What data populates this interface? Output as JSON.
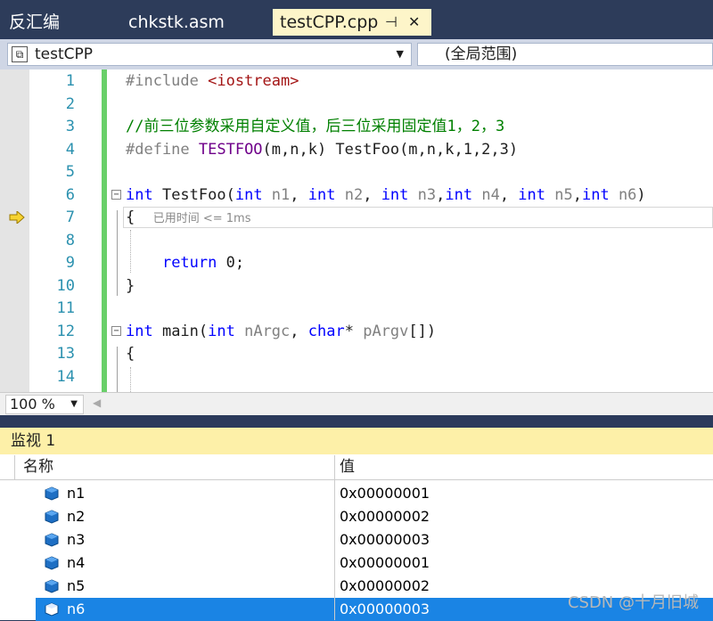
{
  "tabs": {
    "disasm": "反汇编",
    "chkstk": "chkstk.asm",
    "testcpp": "testCPP.cpp",
    "pin_icon": "pin-icon",
    "close_icon": "close-icon"
  },
  "combos": {
    "project": "testCPP",
    "scope": "(全局范围)"
  },
  "line_numbers": [
    "1",
    "2",
    "3",
    "4",
    "5",
    "6",
    "7",
    "8",
    "9",
    "10",
    "11",
    "12",
    "13",
    "14"
  ],
  "code": {
    "l1_pp": "#include ",
    "l1_str": "<iostream>",
    "l3_comment": "//前三位参数采用自定义值，后三位采用固定值1，2，3",
    "l4_pp": "#define ",
    "l4_macro": "TESTFOO",
    "l4_rest_a": "(m,n,k) TestFoo(m,n,k,1,2,3)",
    "l6_int": "int",
    "l6_name": " TestFoo(",
    "l6_int1": "int",
    "l6_p1": " n1",
    "l6_c1": ", ",
    "l6_int2": "int",
    "l6_p2": " n2",
    "l6_c2": ", ",
    "l6_int3": "int",
    "l6_p3": " n3",
    "l6_c3": ",",
    "l6_int4": "int",
    "l6_p4": " n4",
    "l6_c4": ", ",
    "l6_int5": "int",
    "l6_p5": " n5",
    "l6_c5": ",",
    "l6_int6": "int",
    "l6_p6": " n6",
    "l6_end": ")",
    "l7_brace": "{",
    "l7_perf": "已用时间 <= 1ms",
    "l9_return": "return",
    "l9_rest": " 0;",
    "l10_brace": "}",
    "l12_int": "int",
    "l12_main": " main(",
    "l12_int2": "int",
    "l12_p1": " nArgc",
    "l12_comma": ", ",
    "l12_char": "char",
    "l12_star": "* ",
    "l12_p2": "pArgv",
    "l12_end": "[])",
    "l13_brace": "{"
  },
  "zoom": "100 %",
  "watch": {
    "title": "监视 1",
    "col_name": "名称",
    "col_value": "值",
    "rows": [
      {
        "name": "n1",
        "value": "0x00000001"
      },
      {
        "name": "n2",
        "value": "0x00000002"
      },
      {
        "name": "n3",
        "value": "0x00000003"
      },
      {
        "name": "n4",
        "value": "0x00000001"
      },
      {
        "name": "n5",
        "value": "0x00000002"
      },
      {
        "name": "n6",
        "value": "0x00000003"
      }
    ],
    "selected_row": 5
  },
  "watermark": "CSDN @十月旧城"
}
